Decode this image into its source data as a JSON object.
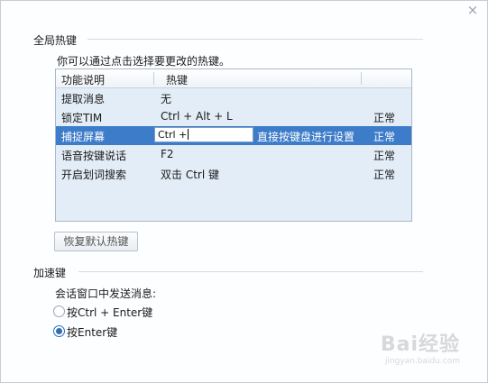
{
  "window": {
    "close_glyph": "×"
  },
  "global_hotkeys": {
    "title": "全局热键",
    "hint": "你可以通过点击选择要更改的热键。",
    "columns": {
      "function": "功能说明",
      "hotkey": "热键"
    },
    "rows": [
      {
        "function": "提取消息",
        "hotkey": "无",
        "status": ""
      },
      {
        "function": "锁定TIM",
        "hotkey": "Ctrl + Alt + L",
        "status": "正常"
      },
      {
        "function": "捕捉屏幕",
        "hotkey": "Ctrl +",
        "hint": "直接按键盘进行设置",
        "status": "正常"
      },
      {
        "function": "语音按键说话",
        "hotkey": "F2",
        "status": "正常"
      },
      {
        "function": "开启划词搜索",
        "hotkey": "双击 Ctrl 键",
        "status": "正常"
      }
    ],
    "selected_row": 2,
    "restore_button": "恢复默认热键"
  },
  "accelerator": {
    "title": "加速键",
    "label": "会话窗口中发送消息:",
    "options": [
      {
        "label": "按Ctrl + Enter键",
        "checked": false
      },
      {
        "label": "按Enter键",
        "checked": true
      }
    ]
  },
  "watermark": {
    "text": "Bai经验",
    "sub": "jingyan.baidu.com"
  },
  "colors": {
    "selected_row": "#3d7cc9",
    "table_bg": "#e3edf7",
    "radio_on": "#2f6fb5"
  }
}
